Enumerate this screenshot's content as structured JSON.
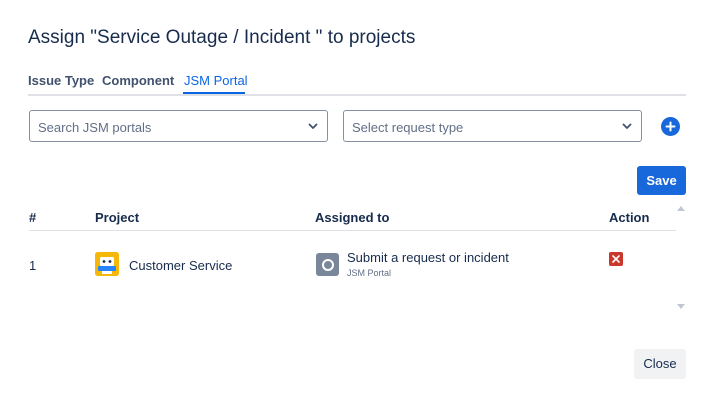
{
  "dialog": {
    "title": "Assign \"Service Outage / Incident \" to projects",
    "tabs": [
      {
        "label": "Issue Type",
        "active": false
      },
      {
        "label": "Component",
        "active": false
      },
      {
        "label": "JSM Portal",
        "active": true
      }
    ],
    "portal_select": {
      "placeholder": "Search JSM portals"
    },
    "request_type_select": {
      "placeholder": "Select request type"
    },
    "add_icon": "plus-circle-icon",
    "save_label": "Save",
    "close_label": "Close",
    "colors": {
      "primary": "#1868db",
      "danger": "#c9372c",
      "project_avatar": "#f5b80a"
    }
  },
  "table": {
    "headers": {
      "num": "#",
      "project": "Project",
      "assigned": "Assigned to",
      "action": "Action"
    },
    "rows": [
      {
        "num": "1",
        "project": "Customer Service",
        "project_icon": "project-avatar-icon",
        "request_type": "Submit a request or incident",
        "request_source": "JSM Portal",
        "request_icon": "request-type-icon",
        "action_icon": "delete-icon"
      }
    ]
  }
}
